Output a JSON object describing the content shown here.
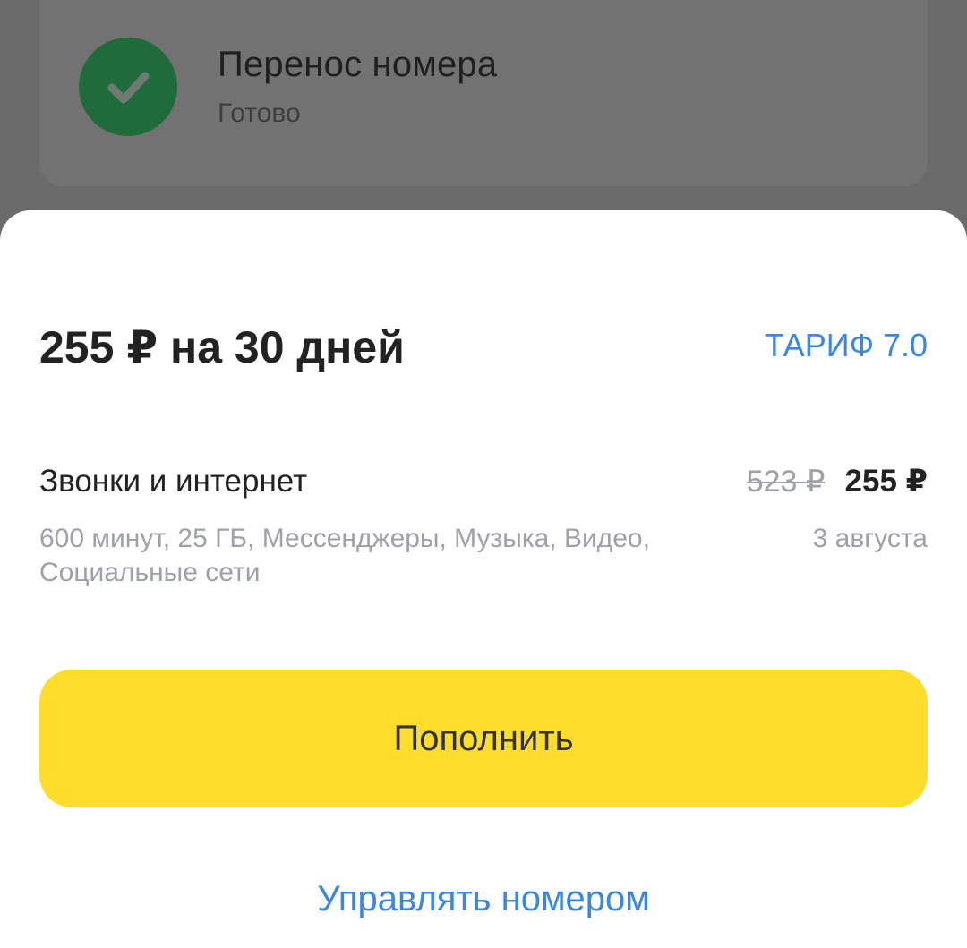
{
  "background_card": {
    "title": "Перенос номера",
    "status": "Готово",
    "icon": "check-icon"
  },
  "sheet": {
    "title": "255 ₽ на 30 дней",
    "tariff_link": "ТАРИФ 7.0",
    "service": {
      "name": "Звонки и интернет",
      "old_price": "523 ₽",
      "new_price": "255 ₽",
      "description": "600 минут, 25 ГБ, Мессенджеры, Музыка, Видео, Социальные сети",
      "date": "3 августа"
    },
    "topup_button": "Пополнить",
    "manage_link": "Управлять номером"
  },
  "colors": {
    "accent_yellow": "#ffdd2d",
    "link_blue": "#3a86e0",
    "success_green": "#1f6b3a",
    "overlay_gray": "#6b6b6b"
  }
}
